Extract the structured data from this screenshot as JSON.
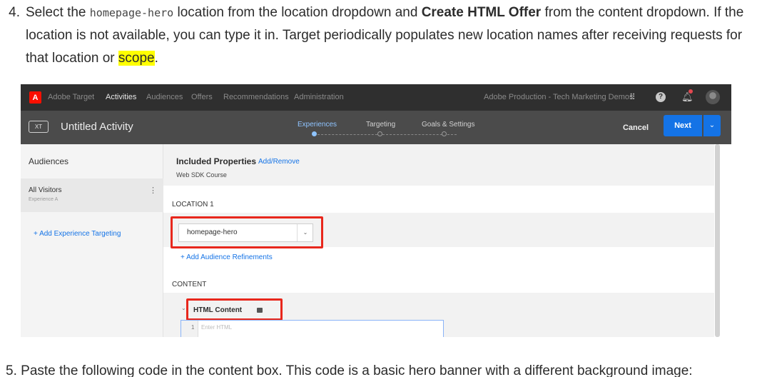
{
  "step4": {
    "number": "4.",
    "t1": "Select the ",
    "code": "homepage-hero",
    "t2": " location from the location dropdown and ",
    "bold": "Create HTML Offer",
    "t3": " from the content dropdown. If the location is not available, you can type it in. Target periodically populates new location names after receiving requests for that location or ",
    "highlight": "scope",
    "t4": "."
  },
  "step5": {
    "number": "5.",
    "text": "Paste the following code in the content box. This code is a basic hero banner with a different background image:"
  },
  "screenshot": {
    "topnav": {
      "logo_glyph": "A",
      "brand": "Adobe Target",
      "items": [
        "Activities",
        "Audiences",
        "Offers",
        "Recommendations",
        "Administration"
      ],
      "org": "Adobe Production - Tech Marketing Demos"
    },
    "activity": {
      "badge": "XT",
      "title": "Untitled Activity",
      "steps": [
        "Experiences",
        "Targeting",
        "Goals & Settings"
      ],
      "cancel": "Cancel",
      "next": "Next"
    },
    "sidebar": {
      "heading": "Audiences",
      "item_title": "All Visitors",
      "item_sub": "Experience A",
      "add_targeting": "+   Add Experience Targeting"
    },
    "main": {
      "included_title": "Included Properties",
      "included_action": "Add/Remove",
      "included_sub": "Web SDK Course",
      "location_label": "LOCATION 1",
      "location_value": "homepage-hero",
      "audience_refine": "+    Add Audience Refinements",
      "content_label": "CONTENT",
      "html_title": "HTML Content",
      "editor_line": "1",
      "editor_placeholder": "Enter HTML"
    },
    "colors": {
      "primary_blue": "#1473e6",
      "callout_red": "#e8271c",
      "highlight_yellow": "#ffff00",
      "topbar": "#2f2f2f",
      "activity_bar": "#4b4b4b"
    }
  }
}
